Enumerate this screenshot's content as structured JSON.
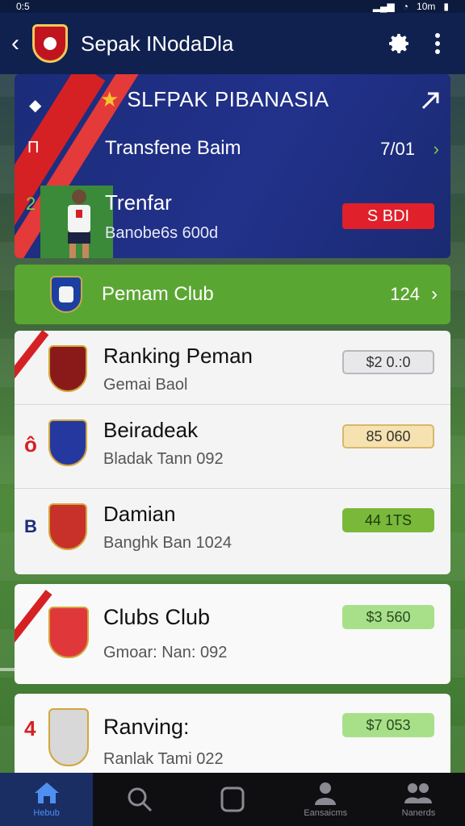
{
  "status": {
    "time": "0:5",
    "right_text": "10m"
  },
  "appbar": {
    "title": "Sepak INodaDla",
    "back_icon": "chevron-left-icon",
    "settings_icon": "gear-icon",
    "more_icon": "more-vertical-icon"
  },
  "hero": {
    "title": "SLFPAK PIBANASIA",
    "subtitle": "Transfene Baim",
    "subtitle_value": "7/01",
    "name": "Trenfar",
    "meta": "Banobe6s 600d",
    "badge": "S BDI",
    "side_glyph_1": "П",
    "side_glyph_2": "2"
  },
  "club_bar": {
    "label": "Pemam Club",
    "value": "124"
  },
  "list": [
    {
      "side": "",
      "title": "Ranking Peman",
      "meta": "Gemai Baol",
      "pill": "$2 0.:0",
      "pill_color": "#e8e8ea",
      "pill_border": "#b8b8bd",
      "crest_color": "#8a1a1a"
    },
    {
      "side": "ô",
      "title": "Beiradeak",
      "meta": "Bladak Tann 092",
      "pill": "85 060",
      "pill_color": "#f6e2b0",
      "pill_border": "#d8b76a",
      "crest_color": "#2438a0"
    },
    {
      "side": "B",
      "title": "Damian",
      "meta": "Banghk Ban 1024",
      "pill": "44 1TS",
      "pill_color": "#7ab83a",
      "pill_border": "#7ab83a",
      "crest_color": "#c7312a"
    }
  ],
  "card_clubs": {
    "title": "Clubs Club",
    "meta": "Gmoar: Nan: 092",
    "pill": "$3 560"
  },
  "card_ranking": {
    "side": "4",
    "title": "Ranving:",
    "meta": "Ranlak Tami 022",
    "pill": "$7 053"
  },
  "nav": [
    {
      "label": "Hebub",
      "icon": "home-icon",
      "active": true
    },
    {
      "label": "",
      "icon": "search-icon",
      "active": false
    },
    {
      "label": "",
      "icon": "square-icon",
      "active": false
    },
    {
      "label": "Eansaicms",
      "icon": "person-icon",
      "active": false
    },
    {
      "label": "Nanerds",
      "icon": "people-icon",
      "active": false
    }
  ]
}
